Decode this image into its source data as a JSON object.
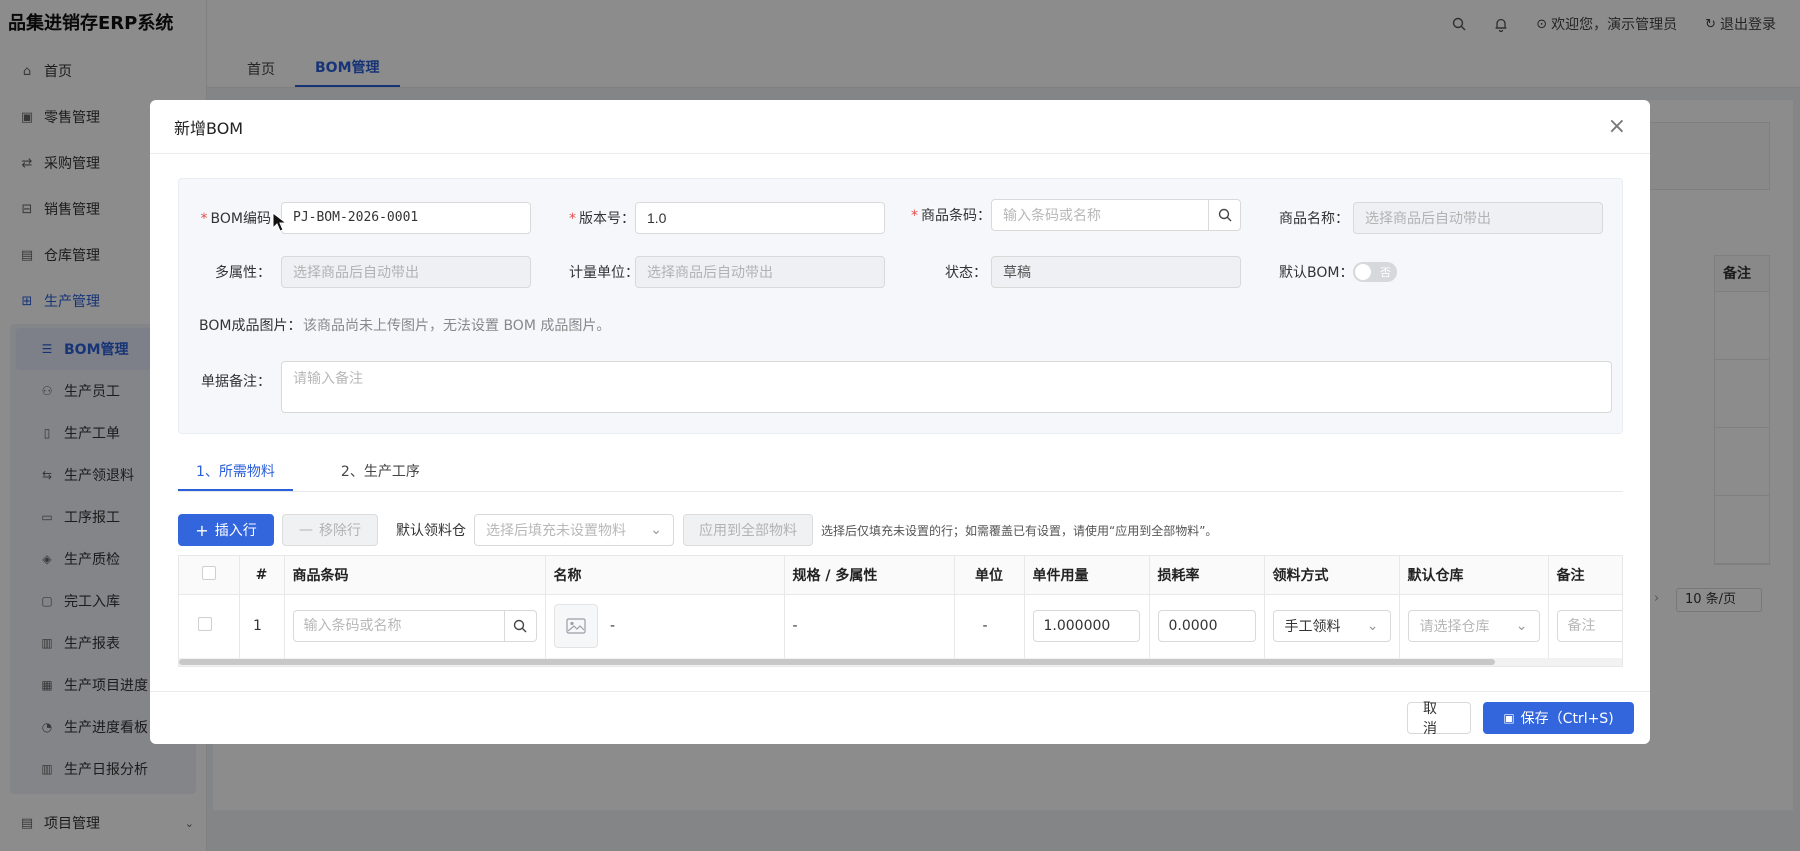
{
  "app": {
    "title": "品集进销存ERP系统"
  },
  "topbar": {
    "welcome": "欢迎您，演示管理员",
    "logout": "退出登录"
  },
  "sidebar": {
    "items": [
      {
        "label": "首页",
        "icon": "home-icon"
      },
      {
        "label": "零售管理",
        "icon": "gift-icon"
      },
      {
        "label": "采购管理",
        "icon": "swap-icon"
      },
      {
        "label": "销售管理",
        "icon": "cart-icon"
      },
      {
        "label": "仓库管理",
        "icon": "warehouse-icon"
      },
      {
        "label": "生产管理",
        "icon": "production-icon"
      }
    ],
    "sub_items": [
      {
        "label": "BOM管理",
        "icon": "list-icon"
      },
      {
        "label": "生产员工",
        "icon": "users-icon"
      },
      {
        "label": "生产工单",
        "icon": "document-icon"
      },
      {
        "label": "生产领退料",
        "icon": "exchange-icon"
      },
      {
        "label": "工序报工",
        "icon": "report-icon"
      },
      {
        "label": "生产质检",
        "icon": "shield-check-icon"
      },
      {
        "label": "完工入库",
        "icon": "inbox-icon"
      },
      {
        "label": "生产报表",
        "icon": "bar-chart-icon"
      },
      {
        "label": "生产项目进度",
        "icon": "calendar-icon"
      },
      {
        "label": "生产进度看板",
        "icon": "dashboard-icon"
      },
      {
        "label": "生产日报分析",
        "icon": "bar-chart-icon"
      }
    ],
    "bottom_item": {
      "label": "项目管理",
      "icon": "project-icon"
    }
  },
  "page_tabs": [
    "首页",
    "BOM管理"
  ],
  "background": {
    "column_header": "备注",
    "page_size": "10 条/页"
  },
  "modal": {
    "title": "新增BOM",
    "form": {
      "bom_code_label": "BOM编码",
      "bom_code_value": "PJ-BOM-2026-0001",
      "version_label": "版本号",
      "version_value": "1.0",
      "barcode_label": "商品条码",
      "barcode_placeholder": "输入条码或名称",
      "name_label": "商品名称",
      "name_placeholder": "选择商品后自动带出",
      "attr_label": "多属性",
      "attr_placeholder": "选择商品后自动带出",
      "unit_label": "计量单位",
      "unit_placeholder": "选择商品后自动带出",
      "status_label": "状态",
      "status_value": "草稿",
      "default_bom_label": "默认BOM",
      "default_bom_toggle": "否",
      "image_label": "BOM成品图片",
      "image_hint": "该商品尚未上传图片，无法设置 BOM 成品图片。",
      "remark_label": "单据备注",
      "remark_placeholder": "请输入备注"
    },
    "tabs": [
      "1、所需物料",
      "2、生产工序"
    ],
    "toolbar": {
      "insert_row": "插入行",
      "remove_row": "移除行",
      "default_warehouse_label": "默认领料仓",
      "default_warehouse_placeholder": "选择后填充未设置物料",
      "apply_all": "应用到全部物料",
      "note": "选择后仅填充未设置的行；如需覆盖已有设置，请使用“应用到全部物料”。"
    },
    "table": {
      "columns": [
        "#",
        "商品条码",
        "名称",
        "规格 / 多属性",
        "单位",
        "单件用量",
        "损耗率",
        "领料方式",
        "默认仓库",
        "备注"
      ],
      "rows": [
        {
          "index": "1",
          "barcode_placeholder": "输入条码或名称",
          "name": "-",
          "spec": "-",
          "unit": "-",
          "qty": "1.000000",
          "loss": "0.0000",
          "pick_mode": "手工领料",
          "warehouse_placeholder": "请选择仓库",
          "remark_placeholder": "备注"
        }
      ]
    },
    "footer": {
      "cancel": "取 消",
      "save": "保存（Ctrl+S)"
    }
  },
  "colors": {
    "primary": "#3366dd",
    "required": "#e34d4d"
  }
}
